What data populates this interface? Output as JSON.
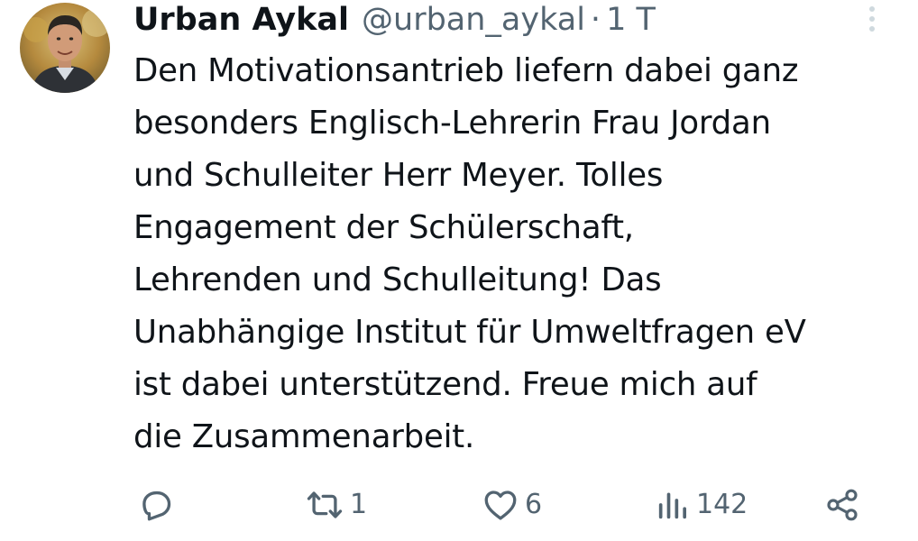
{
  "author": {
    "name": "Urban Aykal",
    "handle": "@urban_aykal",
    "separator": "·",
    "time": "1 T"
  },
  "tweet": {
    "text": "Den Motivationsantrieb liefern dabei ganz\nbesonders Englisch-Lehrerin Frau Jordan\nund Schulleiter Herr Meyer. Tolles\nEngagement der Schülerschaft,\nLehrenden und Schulleitung! Das\nUnabhängige Institut für Umweltfragen eV\nist dabei unterstützend. Freue mich auf\ndie Zusammenarbeit."
  },
  "actions": {
    "replies": "",
    "reposts": "1",
    "likes": "6",
    "views": "142"
  },
  "icons": {
    "more": "more-vertical-icon",
    "reply": "reply-icon",
    "repost": "repost-icon",
    "like": "heart-icon",
    "views": "views-icon",
    "share": "share-icon"
  },
  "colors": {
    "text": "#0f1419",
    "secondary": "#536471",
    "more_dots": "#cfd9de"
  }
}
